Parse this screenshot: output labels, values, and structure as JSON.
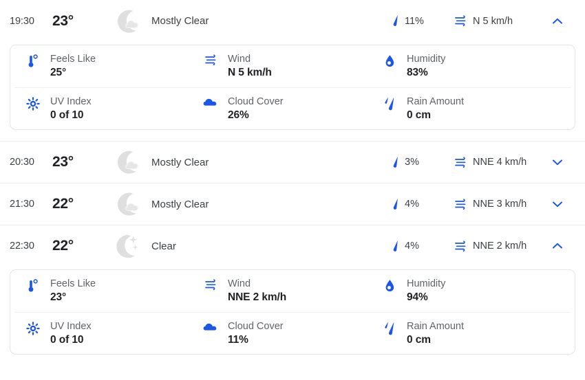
{
  "colors": {
    "accent_blue": "#1a56e8",
    "chevron_blue": "#1a56e8",
    "label_gray": "#5f6368",
    "value_dark": "#202124",
    "moon_gray": "#dfdfdf",
    "divider": "#e8eaed"
  },
  "detail_labels": {
    "feels_like": "Feels Like",
    "wind": "Wind",
    "humidity": "Humidity",
    "uv_index": "UV Index",
    "cloud_cover": "Cloud Cover",
    "rain_amount": "Rain Amount"
  },
  "icons": {
    "precip": "rain-drop-icon",
    "wind": "wind-icon",
    "chevron_up": "chevron-up-icon",
    "chevron_down": "chevron-down-icon",
    "moon_cloud": "moon-cloud-icon",
    "moon_clear": "moon-stars-icon",
    "thermometer": "thermometer-icon",
    "humidity": "water-drop-icon",
    "uv": "sun-burst-icon",
    "cloud": "cloud-icon",
    "rain_amount": "rain-streaks-icon"
  },
  "hours": [
    {
      "time": "19:30",
      "temp": "23°",
      "condition": "Mostly Clear",
      "condition_icon": "moon-cloud-icon",
      "precip": "11%",
      "wind": "N 5 km/h",
      "expanded": true,
      "toggle_state": "expanded",
      "details": {
        "feels_like": "25°",
        "wind": "N 5 km/h",
        "humidity": "83%",
        "uv_index": "0 of 10",
        "cloud_cover": "26%",
        "rain_amount": "0 cm"
      }
    },
    {
      "time": "20:30",
      "temp": "23°",
      "condition": "Mostly Clear",
      "condition_icon": "moon-cloud-icon",
      "precip": "3%",
      "wind": "NNE 4 km/h",
      "expanded": false,
      "toggle_state": "collapsed"
    },
    {
      "time": "21:30",
      "temp": "22°",
      "condition": "Mostly Clear",
      "condition_icon": "moon-cloud-icon",
      "precip": "4%",
      "wind": "NNE 3 km/h",
      "expanded": false,
      "toggle_state": "collapsed"
    },
    {
      "time": "22:30",
      "temp": "22°",
      "condition": "Clear",
      "condition_icon": "moon-stars-icon",
      "precip": "4%",
      "wind": "NNE 2 km/h",
      "expanded": true,
      "toggle_state": "expanded",
      "details": {
        "feels_like": "23°",
        "wind": "NNE 2 km/h",
        "humidity": "94%",
        "uv_index": "0 of 10",
        "cloud_cover": "11%",
        "rain_amount": "0 cm"
      }
    }
  ]
}
